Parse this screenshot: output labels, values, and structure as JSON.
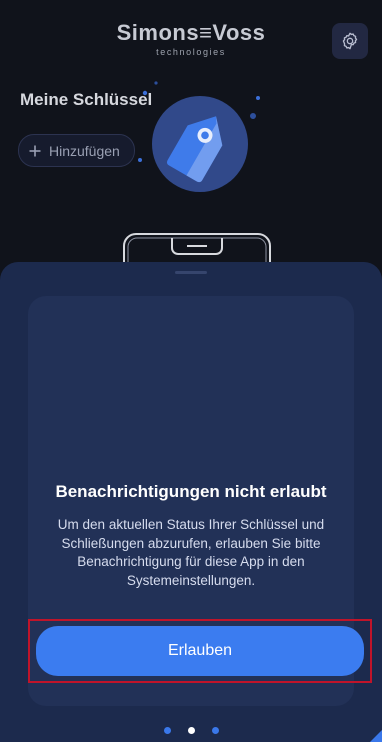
{
  "header": {
    "brand": "Simons≡Voss",
    "tagline": "technologies",
    "settings_icon": "gear-icon"
  },
  "keys": {
    "title": "Meine Schlüssel",
    "add_label": "Hinzufügen"
  },
  "dialog": {
    "title": "Benachrichtigungen nicht erlaubt",
    "body": "Um den aktuellen Status Ihrer Schlüssel und Schließungen abzurufen, erlauben Sie bitte Benachrichtigung für diese App in den Systemeinstellungen.",
    "allow_button": "Erlauben",
    "illustration_icon": "key-tag-icon"
  },
  "pagination": {
    "total": 3,
    "active_index": 1
  },
  "colors": {
    "background": "#10131b",
    "sheet": "#1c2a4d",
    "card": "#223157",
    "accent": "#3b7cf0",
    "highlight": "#c0142a"
  }
}
